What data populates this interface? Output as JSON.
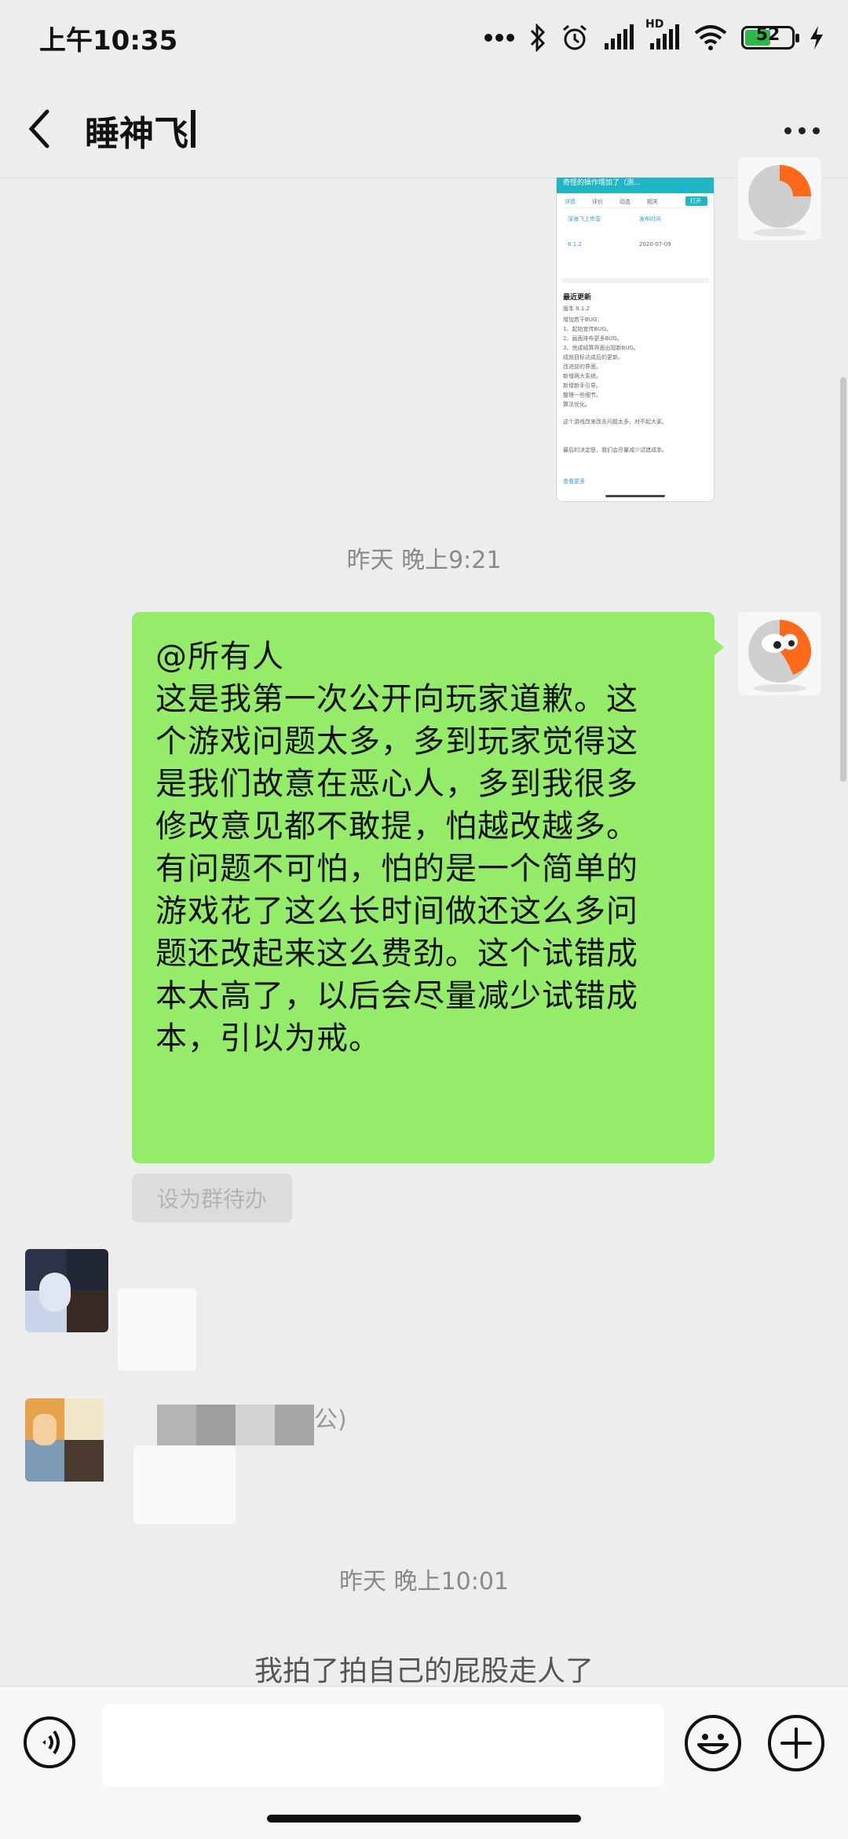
{
  "status_bar": {
    "time": "上午10:35",
    "battery_level": "52",
    "network_badge": "HD",
    "icons": [
      "more-dots-icon",
      "bluetooth-icon",
      "alarm-icon",
      "signal-icon",
      "signal-hd-icon",
      "wifi-icon",
      "battery-icon",
      "charging-icon"
    ]
  },
  "header": {
    "title": "睡神飞",
    "back_icon": "chevron-left-icon",
    "more_icon": "more-icon"
  },
  "screenshot_message": {
    "title": "奇怪的操作增加了（测...",
    "open_button": "打开",
    "tabs": [
      "详情",
      "评价",
      "动态",
      "相关"
    ],
    "fields": [
      "深海飞上市营",
      "发布时间",
      "8.1.2",
      "2020-07-09"
    ],
    "section_title": "最近更新",
    "version": "版本 8.1.2",
    "lines": [
      "增加若干BUG：",
      "1、起始宣传BUG。",
      "2、画面排布更多BUG。",
      "3、完成结算界面出现新BUG。",
      "成就目标达成后的更新。",
      "改进前的界面。",
      "新增两大系统。",
      "新增新手引导。",
      "整理一些细节。",
      "算法优化。",
      "这个游戏改来改去问题太多，对不起大家。",
      "最后的决定是，我们会尽量减少试错成本。"
    ],
    "more_link": "查看更多"
  },
  "messages": {
    "timestamp_1": "昨天 晚上9:21",
    "bubble_lines": [
      "@所有人",
      "这是我第一次公开向玩家道歉。这",
      "个游戏问题太多，多到玩家觉得这",
      "是我们故意在恶心人，多到我很多",
      "修改意见都不敢提，怕越改越多。",
      "有问题不可怕，怕的是一个简单的",
      "游戏花了这么长时间做还这么多问",
      "题还改起来这么费劲。这个试错成",
      "本太高了，以后会尽量减少试错成",
      "本，引以为戒。"
    ],
    "todo_label": "设为群待办",
    "partial_name_tail": "公)",
    "timestamp_2": "昨天 晚上10:01",
    "system_line": "我拍了拍自己的屁股走人了"
  },
  "input_bar": {
    "placeholder": "",
    "voice_icon": "voice-icon",
    "emoji_icon": "emoji-icon",
    "plus_icon": "plus-icon"
  },
  "colors": {
    "background": "#ededed",
    "bubble_green": "#95ec69",
    "accent": "#1aad19"
  }
}
